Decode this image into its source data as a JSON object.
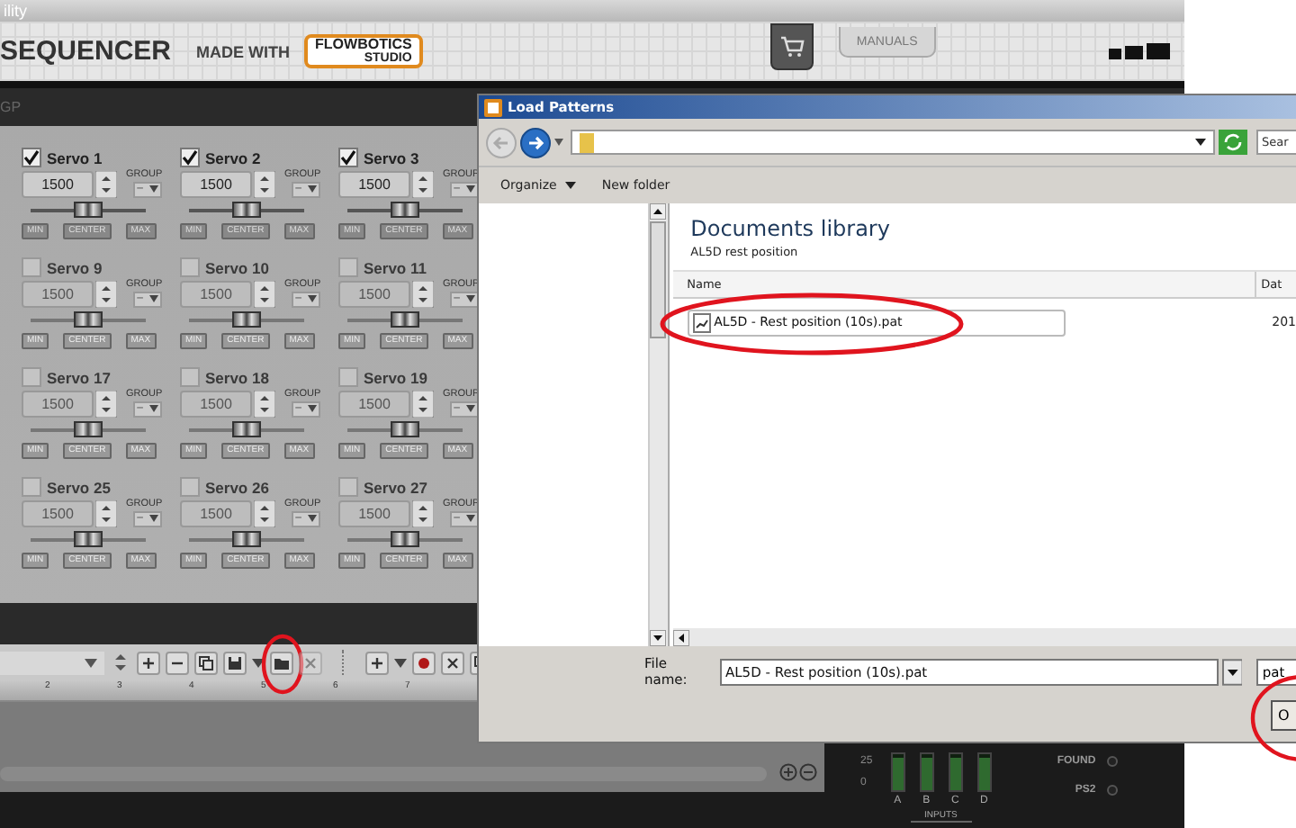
{
  "app": {
    "title": "ility",
    "product": "SEQUENCER",
    "made_with": "MADE WITH",
    "logo_top": "FLOWBOTICS",
    "logo_bottom": "STUDIO",
    "manuals": "MANUALS",
    "section": "GP",
    "servos": [
      {
        "name": "Servo 1",
        "checked": true,
        "value": "1500",
        "group_label": "GROUP",
        "group": "–",
        "level": 0.5,
        "min": "MIN",
        "center": "CENTER",
        "max": "MAX"
      },
      {
        "name": "Servo 2",
        "checked": true,
        "value": "1500",
        "group_label": "GROUP",
        "group": "–",
        "level": 0.5,
        "min": "MIN",
        "center": "CENTER",
        "max": "MAX"
      },
      {
        "name": "Servo 3",
        "checked": true,
        "value": "1500",
        "group_label": "GROUP",
        "group": "–",
        "level": 0.5,
        "min": "MIN",
        "center": "CENTER",
        "max": "MAX"
      },
      {
        "name": "Servo 9",
        "checked": false,
        "value": "1500",
        "group_label": "GROUP",
        "group": "–",
        "level": 0.5,
        "min": "MIN",
        "center": "CENTER",
        "max": "MAX"
      },
      {
        "name": "Servo 10",
        "checked": false,
        "value": "1500",
        "group_label": "GROUP",
        "group": "–",
        "level": 0.5,
        "min": "MIN",
        "center": "CENTER",
        "max": "MAX"
      },
      {
        "name": "Servo 11",
        "checked": false,
        "value": "1500",
        "group_label": "GROUP",
        "group": "–",
        "level": 0.5,
        "min": "MIN",
        "center": "CENTER",
        "max": "MAX"
      },
      {
        "name": "Servo 17",
        "checked": false,
        "value": "1500",
        "group_label": "GROUP",
        "group": "–",
        "level": 0.5,
        "min": "MIN",
        "center": "CENTER",
        "max": "MAX"
      },
      {
        "name": "Servo 18",
        "checked": false,
        "value": "1500",
        "group_label": "GROUP",
        "group": "–",
        "level": 0.5,
        "min": "MIN",
        "center": "CENTER",
        "max": "MAX"
      },
      {
        "name": "Servo 19",
        "checked": false,
        "value": "1500",
        "group_label": "GROUP",
        "group": "–",
        "level": 0.5,
        "min": "MIN",
        "center": "CENTER",
        "max": "MAX"
      },
      {
        "name": "Servo 25",
        "checked": false,
        "value": "1500",
        "group_label": "GROUP",
        "group": "–",
        "level": 0.5,
        "min": "MIN",
        "center": "CENTER",
        "max": "MAX"
      },
      {
        "name": "Servo 26",
        "checked": false,
        "value": "1500",
        "group_label": "GROUP",
        "group": "–",
        "level": 0.5,
        "min": "MIN",
        "center": "CENTER",
        "max": "MAX"
      },
      {
        "name": "Servo 27",
        "checked": false,
        "value": "1500",
        "group_label": "GROUP",
        "group": "–",
        "level": 0.5,
        "min": "MIN",
        "center": "CENTER",
        "max": "MAX"
      }
    ],
    "open_button": {
      "circled": true
    },
    "ruler": [
      "2",
      "3",
      "4",
      "5",
      "6",
      "7"
    ],
    "meter_scale": [
      "25",
      "0"
    ],
    "inputs": [
      {
        "label": "A",
        "level": 0.9
      },
      {
        "label": "B",
        "level": 0.9
      },
      {
        "label": "C",
        "level": 0.9
      },
      {
        "label": "D",
        "level": 0.9
      }
    ],
    "inputs_label": "INPUTS",
    "status": [
      {
        "label": "FOUND",
        "on": false
      },
      {
        "label": "PS2",
        "on": false
      }
    ]
  },
  "dialog": {
    "title": "Load Patterns",
    "search_placeholder": "Sear",
    "organize": "Organize",
    "new_folder": "New folder",
    "library_title": "Documents library",
    "library_subtitle": "AL5D rest position",
    "columns": [
      "Name",
      "Dat"
    ],
    "files": [
      {
        "name": "AL5D - Rest position (10s).pat",
        "date": "201",
        "circled": true
      }
    ],
    "file_name_label": "File name:",
    "file_name_value": "AL5D - Rest position (10s).pat",
    "filter": "pat",
    "open_button": {
      "label": "O",
      "circled": true
    }
  }
}
